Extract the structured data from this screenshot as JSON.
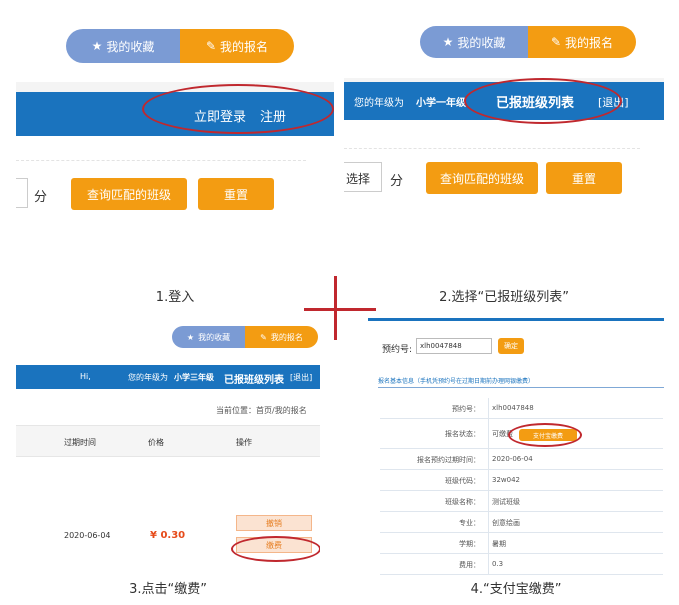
{
  "panel1": {
    "tab_favorites": "我的收藏",
    "tab_registration": "我的报名",
    "login": "立即登录",
    "register": "注册",
    "unit": "分",
    "btn_query": "查询匹配的班级",
    "btn_reset": "重置",
    "caption": "1.登入"
  },
  "panel2": {
    "tab_favorites": "我的收藏",
    "tab_registration": "我的报名",
    "grade_prefix": "您的年级为",
    "grade": "小学一年级",
    "enrolled_list": "已报班级列表",
    "logout": "[退出]",
    "select": "选择",
    "unit": "分",
    "btn_query": "查询匹配的班级",
    "btn_reset": "重置",
    "caption": "2.选择“已报班级列表”"
  },
  "panel3": {
    "tab_favorites": "我的收藏",
    "tab_registration": "我的报名",
    "hi": "Hi,",
    "grade_prefix": "您的年级为",
    "grade": "小学三年级",
    "enrolled_list": "已报班级列表",
    "logout": "[退出]",
    "breadcrumb": "当前位置：首页/我的报名",
    "col_expire": "过期时间",
    "col_price": "价格",
    "col_action": "操作",
    "expire_date": "2020-06-04",
    "price": "¥ 0.30",
    "btn_cancel": "撤销",
    "btn_pay": "缴费",
    "caption": "3.点击“缴费”"
  },
  "panel4": {
    "booking_label": "预约号:",
    "booking_value": "xlh0047848",
    "btn_confirm": "确定",
    "section_title": "报名基本信息（手机凭预约号在过期日期前办理网银缴费）",
    "rows": [
      {
        "k": "预约号：",
        "v": "xlh0047848"
      },
      {
        "k": "报名状态：",
        "v": "可缴费"
      },
      {
        "k": "报名预约过期时间：",
        "v": "2020-06-04"
      },
      {
        "k": "班级代码：",
        "v": "32w042"
      },
      {
        "k": "班级名称：",
        "v": "测试班级"
      },
      {
        "k": "专业：",
        "v": "创意绘画"
      },
      {
        "k": "学期：",
        "v": "暑期"
      },
      {
        "k": "费用：",
        "v": "0.3"
      }
    ],
    "btn_alipay": "支付宝缴费",
    "caption": "4.“支付宝缴费”"
  },
  "colors": {
    "accent": "#f39c12",
    "fav": "#7b9bd4",
    "bar": "#1a73be",
    "ring": "#c0282e"
  }
}
